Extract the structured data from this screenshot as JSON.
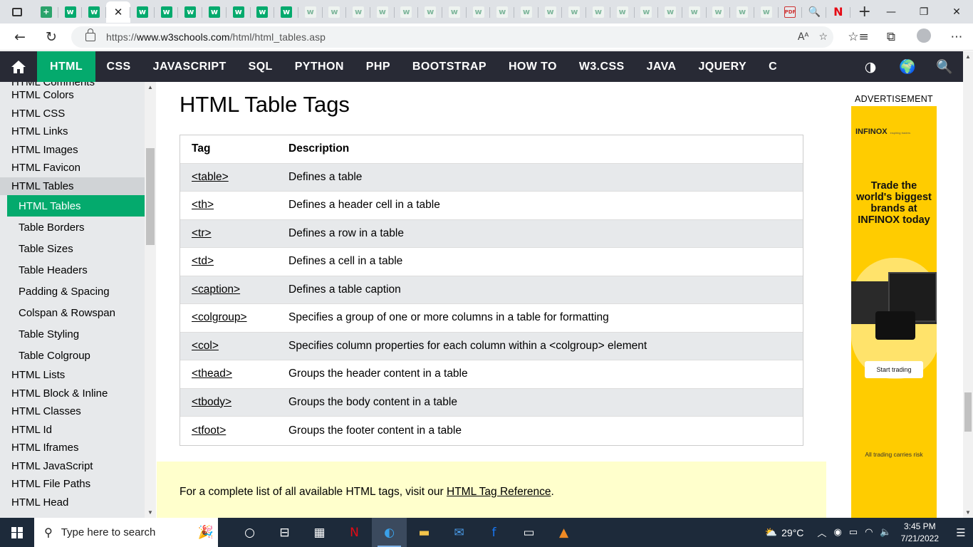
{
  "browser": {
    "tabs": [
      {
        "icon": "sheets-icon",
        "glyph": "+"
      },
      {
        "icon": "w3schools-icon",
        "glyph": "w"
      },
      {
        "icon": "w3schools-icon",
        "glyph": "w"
      },
      {
        "icon": "w3schools-icon",
        "glyph": "w"
      },
      {
        "icon": "w3schools-icon",
        "glyph": "w"
      },
      {
        "icon": "w3schools-icon",
        "glyph": "w"
      },
      {
        "icon": "w3schools-icon",
        "glyph": "w"
      },
      {
        "icon": "w3schools-icon",
        "glyph": "w"
      },
      {
        "icon": "w3schools-icon",
        "glyph": "w"
      },
      {
        "icon": "w3schools-icon",
        "glyph": "w"
      },
      {
        "icon": "w3schools-icon",
        "glyph": "w"
      },
      {
        "icon": "w3schools-icon",
        "glyph": "w"
      },
      {
        "icon": "w3schools-icon",
        "glyph": "w"
      },
      {
        "icon": "w3schools-icon",
        "glyph": "w"
      },
      {
        "icon": "w3schools-icon",
        "glyph": "w"
      },
      {
        "icon": "w3schools-icon",
        "glyph": "w"
      },
      {
        "icon": "w3schools-icon",
        "glyph": "w"
      },
      {
        "icon": "w3schools-icon",
        "glyph": "w"
      },
      {
        "icon": "w3schools-icon",
        "glyph": "w"
      },
      {
        "icon": "w3schools-icon",
        "glyph": "w"
      },
      {
        "icon": "w3schools-icon",
        "glyph": "w"
      },
      {
        "icon": "w3schools-icon",
        "glyph": "w"
      },
      {
        "icon": "w3schools-icon",
        "glyph": "w"
      },
      {
        "icon": "w3schools-icon",
        "glyph": "w"
      },
      {
        "icon": "w3schools-icon",
        "glyph": "w"
      },
      {
        "icon": "w3schools-icon",
        "glyph": "w"
      },
      {
        "icon": "w3schools-icon",
        "glyph": "w"
      },
      {
        "icon": "w3schools-icon",
        "glyph": "w"
      },
      {
        "icon": "w3schools-icon",
        "glyph": "w"
      },
      {
        "icon": "w3schools-icon",
        "glyph": "w"
      },
      {
        "icon": "pdf-icon",
        "glyph": "PDF"
      },
      {
        "icon": "search-icon",
        "glyph": "🔍"
      },
      {
        "icon": "netflix-icon",
        "glyph": "N"
      }
    ],
    "active_tab_close": "✕",
    "new_tab": "+",
    "url_scheme": "https://",
    "url_host": "www.w3schools.com",
    "url_path": "/html/html_tables.asp",
    "omni_icons": [
      "Aᴬ",
      "☆"
    ],
    "toolbar_icons": [
      "☆≡",
      "⧉",
      "⋯"
    ]
  },
  "topnav": {
    "items": [
      "HTML",
      "CSS",
      "JAVASCRIPT",
      "SQL",
      "PYTHON",
      "PHP",
      "BOOTSTRAP",
      "HOW TO",
      "W3.CSS",
      "JAVA",
      "JQUERY",
      "C"
    ],
    "active": "HTML",
    "right_icons": [
      "◑",
      "🌍",
      "🔍"
    ]
  },
  "sidebar": {
    "cut_item": "HTML Comments",
    "items_before": [
      "HTML Colors",
      "HTML CSS",
      "HTML Links",
      "HTML Images",
      "HTML Favicon"
    ],
    "parent": "HTML Tables",
    "sub_items": [
      "HTML Tables",
      "Table Borders",
      "Table Sizes",
      "Table Headers",
      "Padding & Spacing",
      "Colspan & Rowspan",
      "Table Styling",
      "Table Colgroup"
    ],
    "items_after": [
      "HTML Lists",
      "HTML Block & Inline",
      "HTML Classes",
      "HTML Id",
      "HTML Iframes",
      "HTML JavaScript",
      "HTML File Paths",
      "HTML Head"
    ]
  },
  "main": {
    "heading": "HTML Table Tags",
    "table": {
      "headers": [
        "Tag",
        "Description"
      ],
      "rows": [
        [
          "<table>",
          "Defines a table"
        ],
        [
          "<th>",
          "Defines a header cell in a table"
        ],
        [
          "<tr>",
          "Defines a row in a table"
        ],
        [
          "<td>",
          "Defines a cell in a table"
        ],
        [
          "<caption>",
          "Defines a table caption"
        ],
        [
          "<colgroup>",
          "Specifies a group of one or more columns in a table for formatting"
        ],
        [
          "<col>",
          "Specifies column properties for each column within a <colgroup> element"
        ],
        [
          "<thead>",
          "Groups the header content in a table"
        ],
        [
          "<tbody>",
          "Groups the body content in a table"
        ],
        [
          "<tfoot>",
          "Groups the footer content in a table"
        ]
      ]
    },
    "note_prefix": "For a complete list of all available HTML tags, visit our ",
    "note_link": "HTML Tag Reference",
    "note_suffix": "."
  },
  "ad": {
    "label": "ADVERTISEMENT",
    "brand": "INFINOX",
    "tagline": "inspiring traders",
    "headline": "Trade the world's biggest brands at INFINOX today",
    "cta": "Start trading",
    "disclaimer": "All trading carries risk"
  },
  "taskbar": {
    "search_placeholder": "Type here to search",
    "apps": [
      {
        "icon": "task-view-icon",
        "glyph": "○"
      },
      {
        "icon": "timeline-icon",
        "glyph": "⊟"
      },
      {
        "icon": "store-icon",
        "glyph": "▦"
      },
      {
        "icon": "netflix-icon",
        "glyph": "N"
      },
      {
        "icon": "edge-icon",
        "glyph": "◐"
      },
      {
        "icon": "file-explorer-icon",
        "glyph": "▬"
      },
      {
        "icon": "mail-icon",
        "glyph": "✉"
      },
      {
        "icon": "facebook-icon",
        "glyph": "f"
      },
      {
        "icon": "terminal-icon",
        "glyph": "▭"
      },
      {
        "icon": "vlc-icon",
        "glyph": "▲"
      }
    ],
    "active_app": "edge-icon",
    "weather": "29°C",
    "time": "3:45 PM",
    "date": "7/21/2022"
  },
  "colors": {
    "w3_green": "#04aa6d",
    "topnav_bg": "#282a35",
    "sidebar_bg": "#e7e9eb",
    "note_bg": "#ffffcc",
    "ad_bg": "#ffcc00"
  }
}
